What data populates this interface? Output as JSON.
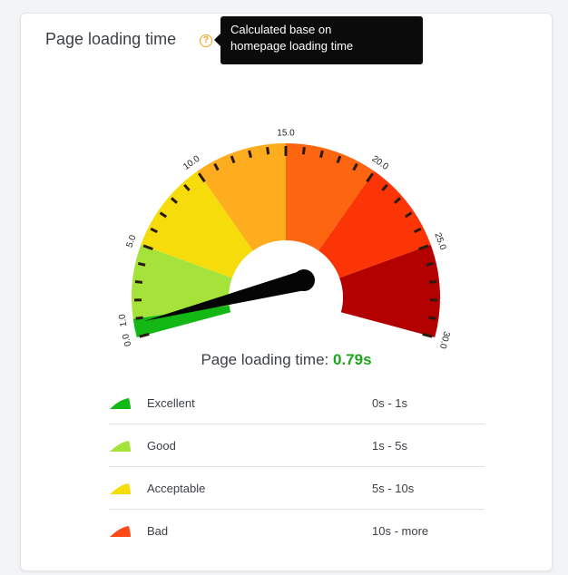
{
  "card": {
    "title": "Page loading time",
    "help_icon": "question-circle-icon",
    "tooltip": [
      "Calculated base on",
      "homepage loading time"
    ]
  },
  "gauge": {
    "min": 0,
    "max": 30,
    "value": 0.79,
    "tick_labels": [
      "0.0",
      "1.0",
      "5.0",
      "10.0",
      "15.0",
      "20.0",
      "25.0",
      "30.0"
    ],
    "bands": [
      {
        "from": 0,
        "to": 1,
        "color": "#14b814"
      },
      {
        "from": 1,
        "to": 5,
        "color": "#a6e33a"
      },
      {
        "from": 5,
        "to": 10,
        "color": "#f5dc0a"
      },
      {
        "from": 10,
        "to": 15,
        "color": "#fdad1e"
      },
      {
        "from": 15,
        "to": 20,
        "color": "#fd6510"
      },
      {
        "from": 20,
        "to": 25,
        "color": "#fb3506"
      },
      {
        "from": 25,
        "to": 30,
        "color": "#b30000"
      }
    ]
  },
  "result": {
    "label": "Page loading time:",
    "value": "0.79s"
  },
  "legend": [
    {
      "label": "Excellent",
      "range": "0s - 1s",
      "color": "#14b814"
    },
    {
      "label": "Good",
      "range": "1s - 5s",
      "color": "#a6e33a"
    },
    {
      "label": "Acceptable",
      "range": "5s - 10s",
      "color": "#f5dc0a"
    },
    {
      "label": "Bad",
      "range": "10s - more",
      "color": "#fb4a16"
    }
  ]
}
